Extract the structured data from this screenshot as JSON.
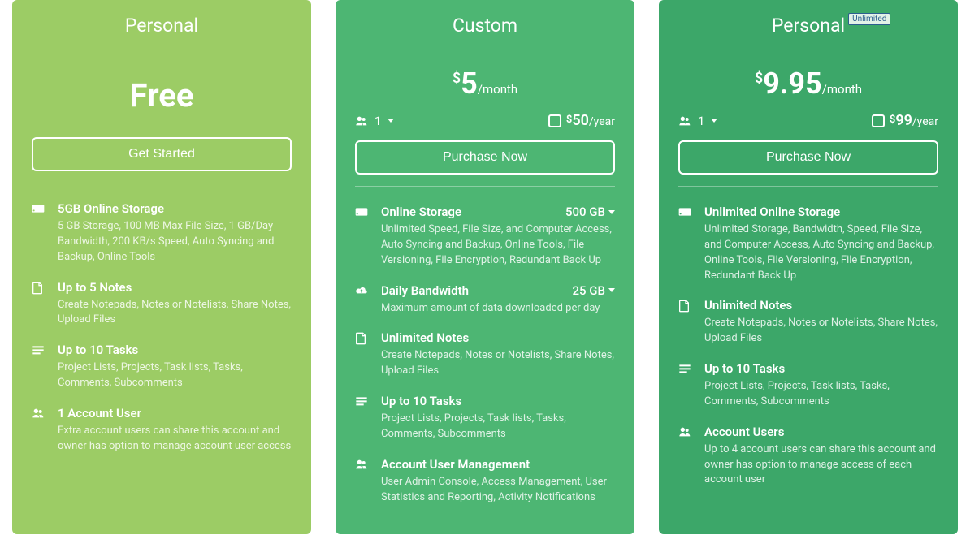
{
  "plans": [
    {
      "id": "free",
      "title": "Personal",
      "badge": null,
      "price_simple": "Free",
      "cta": "Get Started",
      "features": [
        {
          "icon": "hdd",
          "title": "5GB Online Storage",
          "value": null,
          "desc": "5 GB Storage, 100 MB Max File Size, 1 GB/Day Bandwidth, 200 KB/s Speed, Auto Syncing and Backup, Online Tools"
        },
        {
          "icon": "note",
          "title": "Up to 5 Notes",
          "value": null,
          "desc": "Create Notepads, Notes or Notelists, Share Notes, Upload Files"
        },
        {
          "icon": "tasks",
          "title": "Up to 10 Tasks",
          "value": null,
          "desc": "Project Lists, Projects, Task lists, Tasks, Comments, Subcomments"
        },
        {
          "icon": "users",
          "title": "1 Account User",
          "value": null,
          "desc": "Extra account users can share this account and owner has option to manage account user access"
        }
      ]
    },
    {
      "id": "custom",
      "title": "Custom",
      "badge": null,
      "price_currency": "$",
      "price_amount": "5",
      "price_period": "/month",
      "users_value": "1",
      "yearly_currency": "$",
      "yearly_amount": "50",
      "yearly_period": "/year",
      "cta": "Purchase Now",
      "features": [
        {
          "icon": "hdd",
          "title": "Online Storage",
          "value": "500 GB",
          "dropdown": true,
          "desc": "Unlimited Speed, File Size, and Computer Access, Auto Syncing and Backup, Online Tools, File Versioning, File Encryption, Redundant Back Up"
        },
        {
          "icon": "cloud",
          "title": "Daily Bandwidth",
          "value": "25 GB",
          "dropdown": true,
          "desc": "Maximum amount of data downloaded per day"
        },
        {
          "icon": "note",
          "title": "Unlimited Notes",
          "value": null,
          "desc": "Create Notepads, Notes or Notelists, Share Notes, Upload Files"
        },
        {
          "icon": "tasks",
          "title": "Up to 10 Tasks",
          "value": null,
          "desc": "Project Lists, Projects, Task lists, Tasks, Comments, Subcomments"
        },
        {
          "icon": "users",
          "title": "Account User Management",
          "value": null,
          "desc": "User Admin Console, Access Management, User Statistics and Reporting, Activity Notifications"
        }
      ]
    },
    {
      "id": "premium",
      "title": "Personal",
      "badge": "Unlimited",
      "price_currency": "$",
      "price_amount": "9.95",
      "price_period": "/month",
      "users_value": "1",
      "yearly_currency": "$",
      "yearly_amount": "99",
      "yearly_period": "/year",
      "cta": "Purchase Now",
      "features": [
        {
          "icon": "hdd",
          "title": "Unlimited Online Storage",
          "value": null,
          "desc": "Unlimited Storage, Bandwidth, Speed, File Size, and Computer Access, Auto Syncing and Backup, Online Tools, File Versioning, File Encryption, Redundant Back Up"
        },
        {
          "icon": "note",
          "title": "Unlimited Notes",
          "value": null,
          "desc": "Create Notepads, Notes or Notelists, Share Notes, Upload Files"
        },
        {
          "icon": "tasks",
          "title": "Up to 10 Tasks",
          "value": null,
          "desc": "Project Lists, Projects, Task lists, Tasks, Comments, Subcomments"
        },
        {
          "icon": "users",
          "title": "Account Users",
          "value": null,
          "desc": "Up to 4 account users can share this account and owner has option to manage access of each account user"
        }
      ]
    }
  ]
}
